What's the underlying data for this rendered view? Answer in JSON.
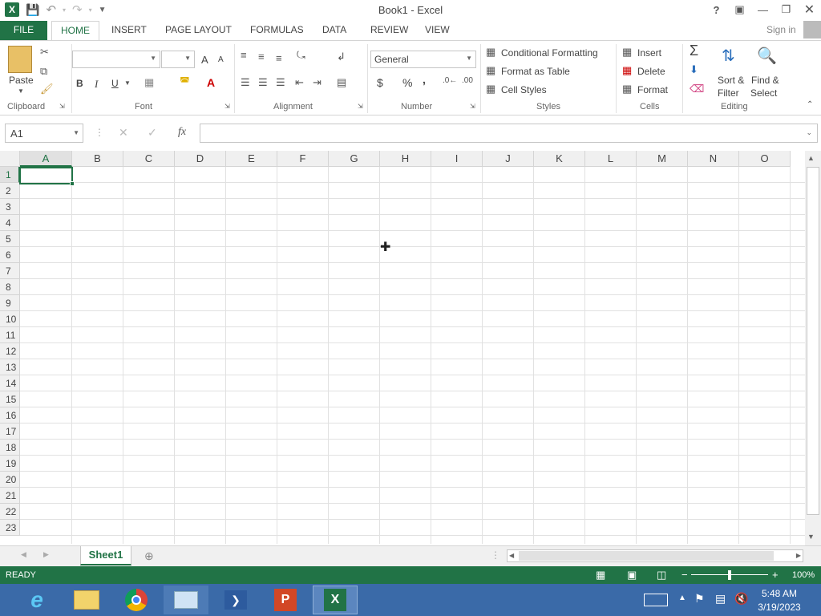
{
  "app": {
    "title": "Book1 - Excel",
    "signin": "Sign in",
    "help": "?"
  },
  "tabs": [
    "FILE",
    "HOME",
    "INSERT",
    "PAGE LAYOUT",
    "FORMULAS",
    "DATA",
    "REVIEW",
    "VIEW"
  ],
  "ribbon": {
    "clipboard": {
      "label": "Clipboard",
      "paste": "Paste"
    },
    "font": {
      "label": "Font",
      "name": "",
      "size": "",
      "bold": "B",
      "italic": "I",
      "underline": "U",
      "grow": "A",
      "shrink": "A",
      "fontcolor": "A"
    },
    "alignment": {
      "label": "Alignment"
    },
    "number": {
      "label": "Number",
      "format": "General",
      "currency": "$",
      "percent": "%",
      "comma": ","
    },
    "styles": {
      "label": "Styles",
      "conditional": "Conditional Formatting",
      "format_table": "Format as Table",
      "cell_styles": "Cell Styles"
    },
    "cells": {
      "label": "Cells",
      "insert": "Insert",
      "delete": "Delete",
      "format": "Format"
    },
    "editing": {
      "label": "Editing",
      "sigma": "Σ",
      "sort1": "Sort &",
      "sort2": "Filter",
      "find1": "Find &",
      "find2": "Select"
    }
  },
  "formula_bar": {
    "name_box": "A1",
    "fx": "fx",
    "value": ""
  },
  "grid": {
    "columns": [
      "A",
      "B",
      "C",
      "D",
      "E",
      "F",
      "G",
      "H",
      "I",
      "J",
      "K",
      "L",
      "M",
      "N",
      "O"
    ],
    "rows": [
      "1",
      "2",
      "3",
      "4",
      "5",
      "6",
      "7",
      "8",
      "9",
      "10",
      "11",
      "12",
      "13",
      "14",
      "15",
      "16",
      "17",
      "18",
      "19",
      "20",
      "21",
      "22",
      "23"
    ],
    "selected": "A1"
  },
  "sheets": [
    "Sheet1"
  ],
  "status": {
    "ready": "READY",
    "zoom": "100%"
  },
  "taskbar": {
    "time": "5:48 AM",
    "date": "3/19/2023"
  },
  "colors": {
    "accent": "#217346",
    "taskbar": "#3a6aa8"
  }
}
